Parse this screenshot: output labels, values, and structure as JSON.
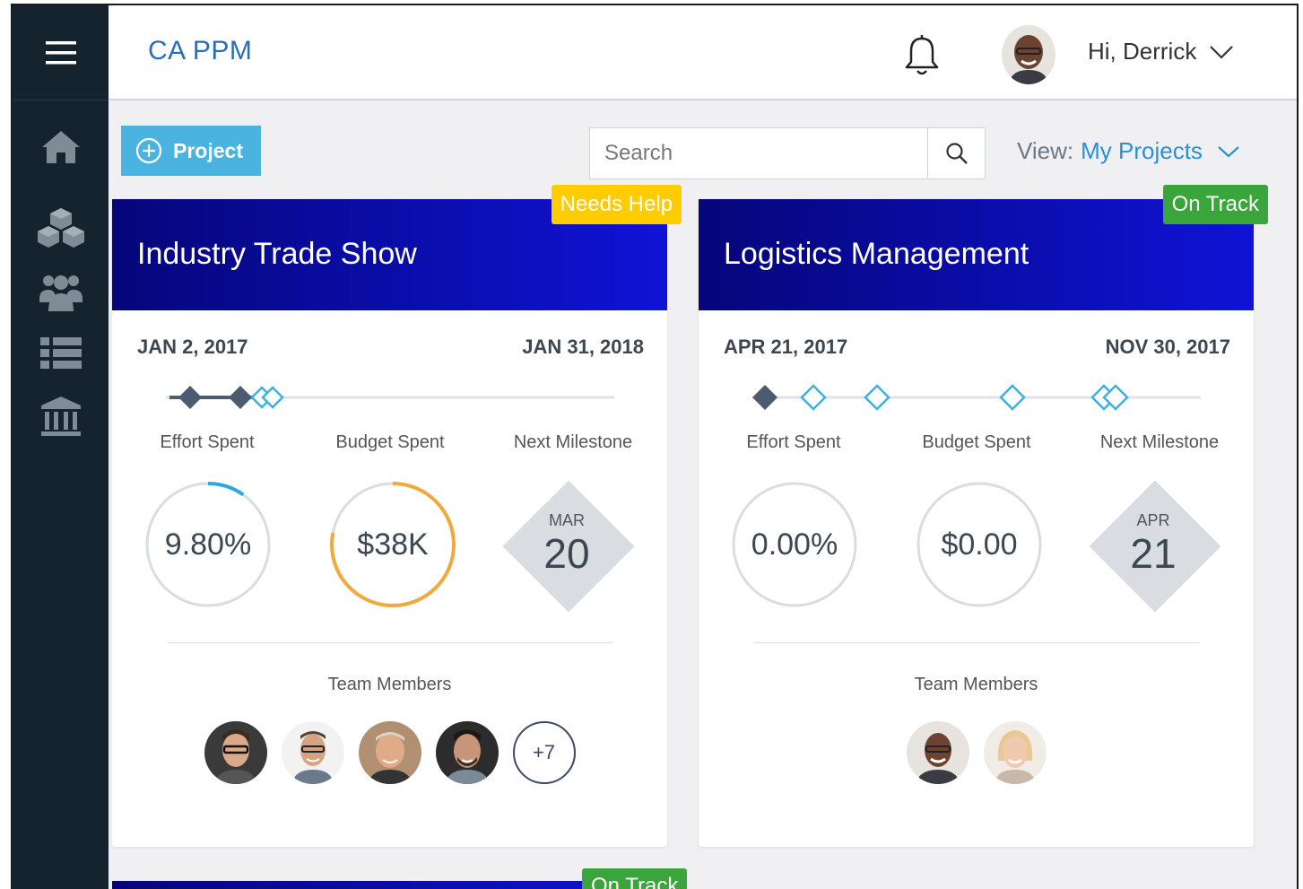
{
  "app": {
    "title": "CA PPM"
  },
  "user": {
    "greeting": "Hi, Derrick"
  },
  "toolbar": {
    "add_label": "Project",
    "search_placeholder": "Search",
    "view_label": "View:",
    "view_value": "My Projects"
  },
  "sidebar": {
    "items": [
      {
        "icon": "home-icon"
      },
      {
        "icon": "cubes-icon"
      },
      {
        "icon": "users-icon"
      },
      {
        "icon": "list-icon"
      },
      {
        "icon": "bank-icon"
      }
    ]
  },
  "labels": {
    "effort": "Effort Spent",
    "budget": "Budget Spent",
    "milestone": "Next Milestone",
    "team": "Team Members"
  },
  "projects": [
    {
      "title": "Industry Trade Show",
      "status": "Needs Help",
      "start": "JAN 2, 2017",
      "end": "JAN 31, 2018",
      "effort": "9.80%",
      "effort_fraction": 0.098,
      "budget": "$38K",
      "budget_fraction": 0.78,
      "milestone_month": "MAR",
      "milestone_day": "20",
      "more_members": "+7"
    },
    {
      "title": "Logistics Management",
      "status": "On Track",
      "start": "APR 21, 2017",
      "end": "NOV 30, 2017",
      "effort": "0.00%",
      "effort_fraction": 0,
      "budget": "$0.00",
      "budget_fraction": 0,
      "milestone_month": "APR",
      "milestone_day": "21"
    },
    {
      "status": "On Track"
    }
  ],
  "colors": {
    "brand": "#2a6fb3",
    "add_button": "#4ab3e0",
    "needs_help": "#ffcc00",
    "on_track": "#3aa53a",
    "effort_ring": "#2aa8e0",
    "budget_ring": "#f0a93a"
  }
}
